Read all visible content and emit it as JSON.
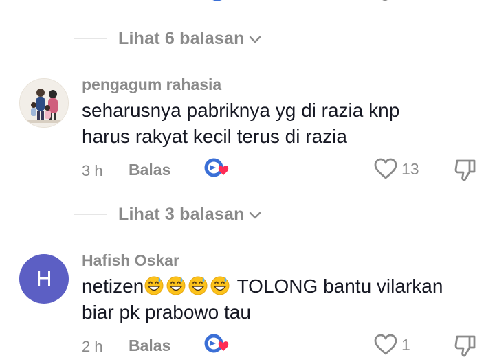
{
  "threads": [
    {
      "replies_label": "Lihat 6 balasan"
    },
    {
      "username": "pengagum rahasia",
      "text": "seharusnya pabriknya yg di razia knp\nharus rakyat kecil terus di razia",
      "time": "3 h",
      "reply_label": "Balas",
      "likes": "13",
      "replies_label": "Lihat 3 balasan"
    },
    {
      "username": "Hafish Oskar",
      "avatar_letter": "H",
      "text_prefix": "netizen",
      "text_suffix": " TOLONG bantu vilarkan\nbiar pk prabowo tau",
      "emoji_count": 4,
      "emoji_icon": "grinning-sweat-emoji",
      "time": "2 h",
      "reply_label": "Balas",
      "likes": "1"
    }
  ],
  "colors": {
    "meta_gray": "#8a8a8a",
    "text_dark": "#161823",
    "avatar_purple": "#5c5fc4",
    "heart_red": "#fe2c55",
    "reaction_blue": "#3b6fd6"
  },
  "icons": {
    "reaction": "reaction-heart-icon",
    "like": "heart-outline-icon",
    "dislike": "thumbs-down-icon",
    "expand": "chevron-down-icon"
  }
}
